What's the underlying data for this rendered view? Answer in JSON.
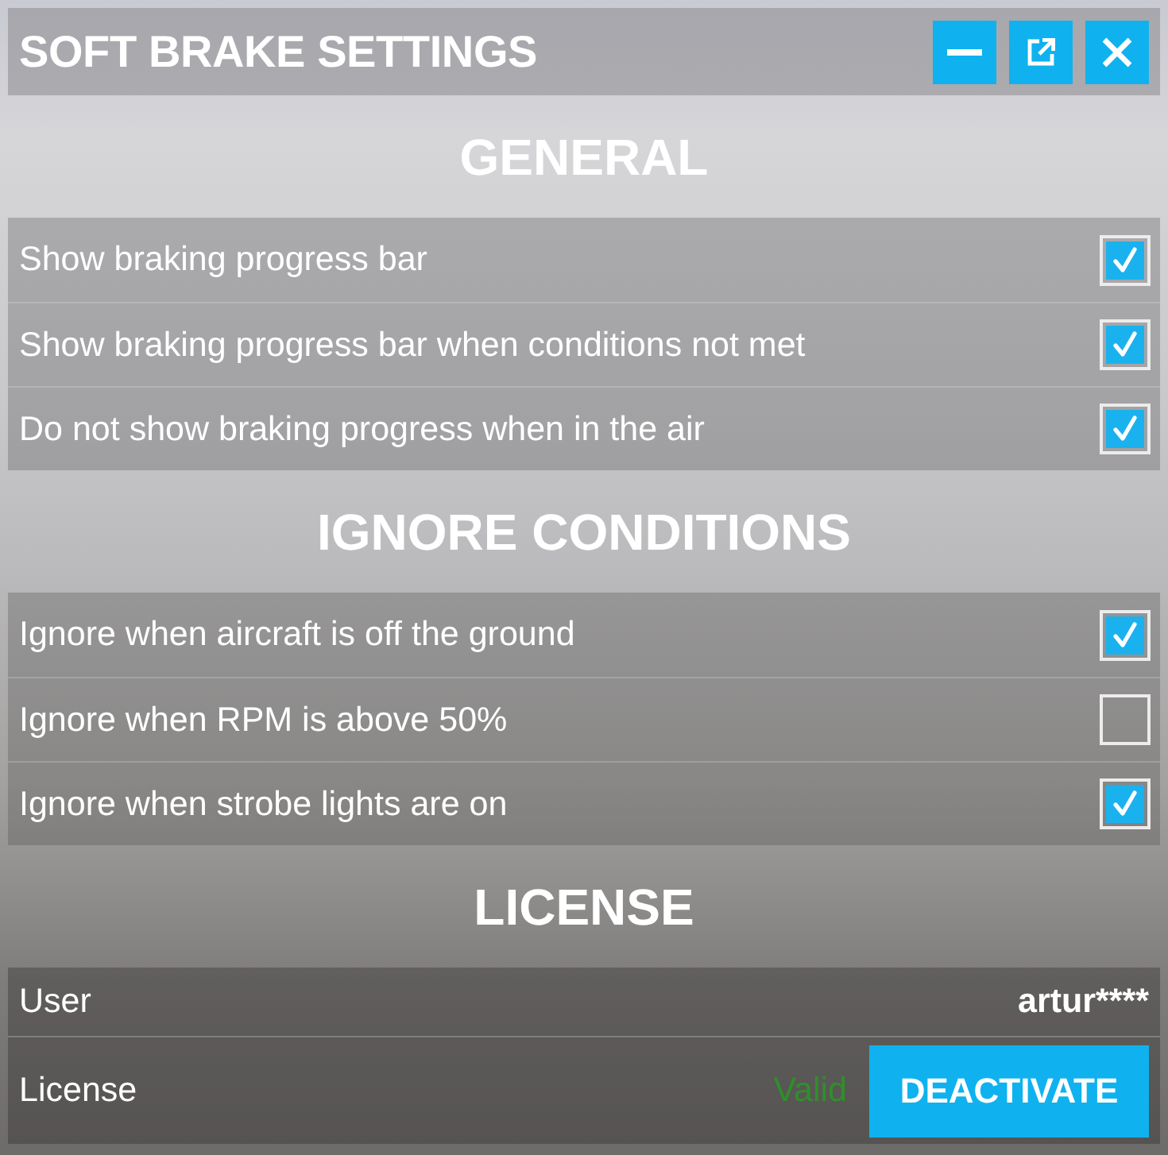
{
  "window": {
    "title": "SOFT BRAKE SETTINGS",
    "buttons": [
      {
        "kind": "minimize"
      },
      {
        "kind": "popout"
      },
      {
        "kind": "close"
      }
    ]
  },
  "sections": [
    {
      "title": "GENERAL",
      "options": [
        {
          "label": "Show braking progress bar",
          "checked": true
        },
        {
          "label": "Show braking progress bar when conditions not met",
          "checked": true
        },
        {
          "label": "Do not show braking progress when in the air",
          "checked": true
        }
      ]
    },
    {
      "title": "IGNORE CONDITIONS",
      "options": [
        {
          "label": "Ignore when aircraft is off the ground",
          "checked": true
        },
        {
          "label": "Ignore when RPM is above 50%",
          "checked": false
        },
        {
          "label": "Ignore when strobe lights are on",
          "checked": true
        }
      ]
    }
  ],
  "license": {
    "title": "LICENSE",
    "rows": [
      {
        "kind": "value",
        "label": "User",
        "value": "artur****"
      },
      {
        "kind": "status",
        "label": "License",
        "status": "Valid",
        "button": "DEACTIVATE"
      }
    ]
  }
}
